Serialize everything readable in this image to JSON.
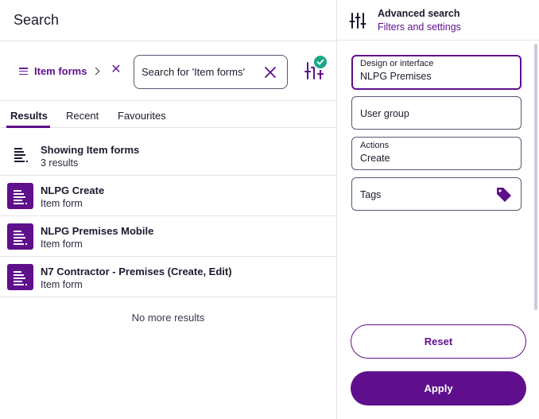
{
  "search_panel": {
    "title": "Search",
    "filter_chip": {
      "label": "Item forms"
    },
    "search": {
      "value": "Search for 'Item forms'",
      "placeholder": "Search for 'Item forms'"
    },
    "tabs": [
      {
        "label": "Results",
        "active": true
      },
      {
        "label": "Recent",
        "active": false
      },
      {
        "label": "Favourites",
        "active": false
      }
    ],
    "summary": {
      "title": "Showing Item forms",
      "count": "3 results"
    },
    "results": [
      {
        "title": "NLPG Create",
        "type": "Item form"
      },
      {
        "title": "NLPG Premises Mobile",
        "type": "Item form"
      },
      {
        "title": "N7 Contractor - Premises (Create, Edit)",
        "type": "Item form"
      }
    ],
    "end_text": "No more results"
  },
  "advanced_panel": {
    "title": "Advanced search",
    "subtitle": "Filters and settings",
    "fields": {
      "design": {
        "label": "Design or interface",
        "value": "NLPG Premises"
      },
      "user_group": {
        "label": "User group"
      },
      "actions": {
        "label": "Actions",
        "value": "Create"
      },
      "tags": {
        "label": "Tags"
      }
    },
    "reset_label": "Reset",
    "apply_label": "Apply"
  },
  "colors": {
    "brand": "#5f0f8c",
    "badge": "#1aa787",
    "border": "#e4e2ea"
  },
  "icons": [
    "menu-icon",
    "chevron-right-icon",
    "close-icon",
    "clear-icon",
    "filter-sliders-icon",
    "check-badge-icon",
    "list-icon",
    "form-icon",
    "tag-icon"
  ]
}
